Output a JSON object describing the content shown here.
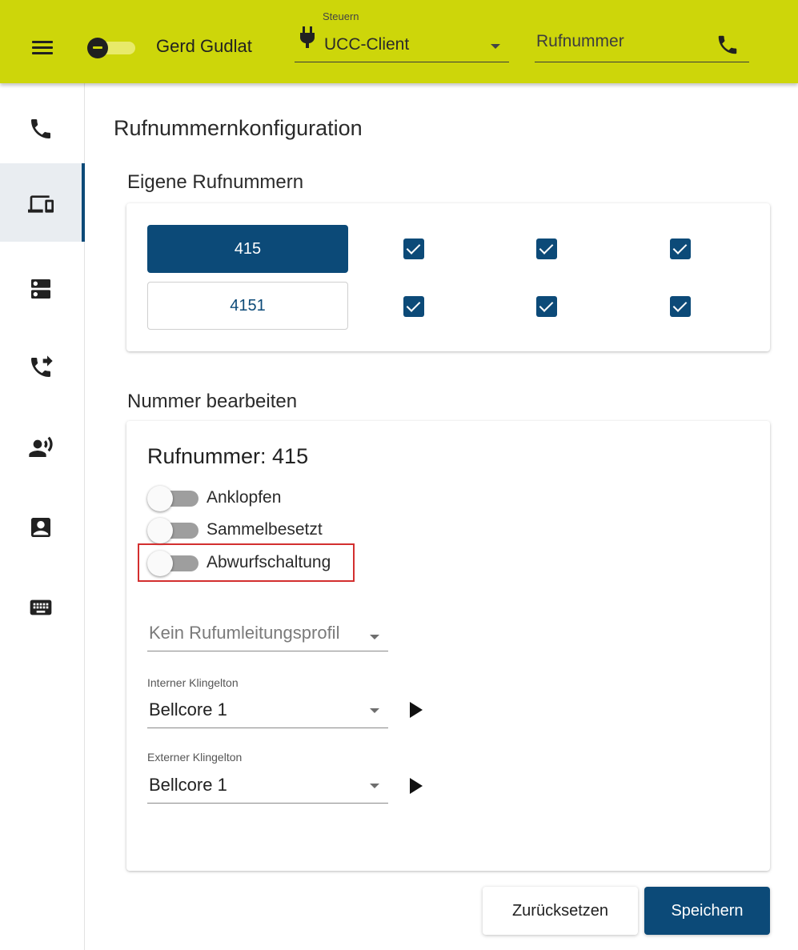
{
  "header": {
    "user_name": "Gerd Gudlat",
    "control_label": "Steuern",
    "control_value": "UCC-Client",
    "number_placeholder": "Rufnummer"
  },
  "sidebar": {
    "items": [
      {
        "icon": "phone-icon",
        "active": false
      },
      {
        "icon": "devices-icon",
        "active": true
      },
      {
        "icon": "server-icon",
        "active": false
      },
      {
        "icon": "call-forward-icon",
        "active": false
      },
      {
        "icon": "person-voice-icon",
        "active": false
      },
      {
        "icon": "contact-card-icon",
        "active": false
      },
      {
        "icon": "keyboard-icon",
        "active": false
      }
    ]
  },
  "page": {
    "title": "Rufnummernkonfiguration",
    "own_numbers_title": "Eigene Rufnummern",
    "edit_title": "Nummer bearbeiten"
  },
  "own_numbers": [
    {
      "number": "415",
      "selected": true,
      "checks": [
        true,
        true,
        true
      ]
    },
    {
      "number": "4151",
      "selected": false,
      "checks": [
        true,
        true,
        true
      ]
    }
  ],
  "edit": {
    "heading": "Rufnummer: 415",
    "toggles": [
      {
        "label": "Anklopfen",
        "on": false
      },
      {
        "label": "Sammelbesetzt",
        "on": false
      },
      {
        "label": "Abwurfschaltung",
        "on": false
      }
    ],
    "forwarding_profile_placeholder": "Kein Rufumleitungsprofil",
    "internal_ringtone_label": "Interner Klingelton",
    "internal_ringtone_value": "Bellcore 1",
    "external_ringtone_label": "Externer Klingelton",
    "external_ringtone_value": "Bellcore 1"
  },
  "actions": {
    "reset_label": "Zurücksetzen",
    "save_label": "Speichern"
  },
  "colors": {
    "topbar": "#cdd60a",
    "primary": "#0c4a78",
    "highlight": "#d32f2f"
  }
}
